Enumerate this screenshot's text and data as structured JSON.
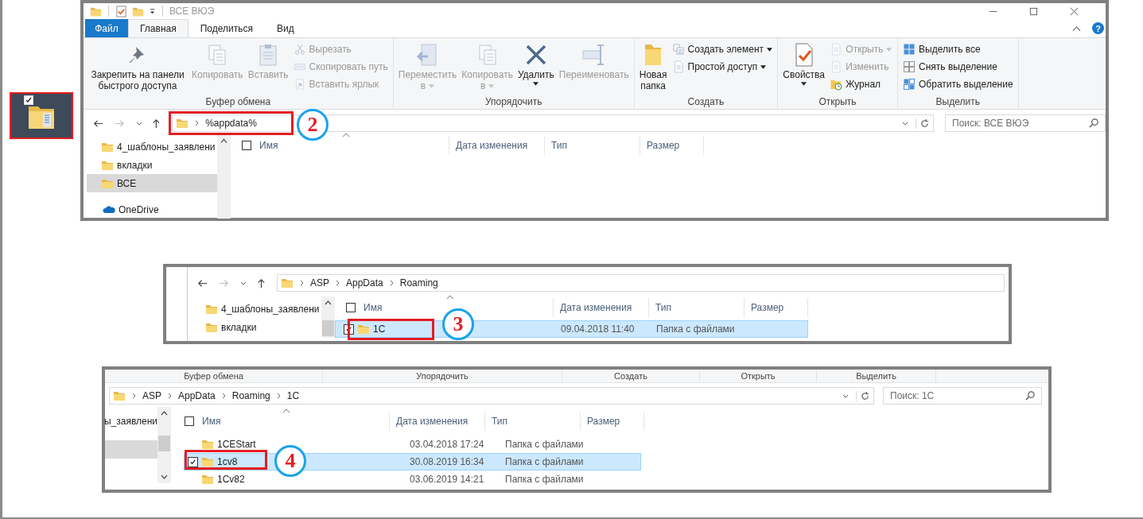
{
  "desktop_icon": {
    "checked": true
  },
  "window": {
    "title": "ВСЕ ВЮЭ",
    "help": "?",
    "tabs": [
      {
        "label": "Файл",
        "kind": "file",
        "selected": false
      },
      {
        "label": "Главная",
        "kind": "tab",
        "selected": true
      },
      {
        "label": "Поделиться",
        "kind": "tab",
        "selected": false
      },
      {
        "label": "Вид",
        "kind": "tab",
        "selected": false
      }
    ],
    "ribbon": [
      {
        "label": "Буфер обмена",
        "items": [
          {
            "label": "Закрепить на панели быстрого доступа",
            "kind": "large",
            "disabled": false,
            "dropdown": false
          },
          {
            "label": "Копировать",
            "kind": "large",
            "disabled": true,
            "dropdown": false
          },
          {
            "label": "Вставить",
            "kind": "large",
            "disabled": true,
            "dropdown": false
          },
          {
            "label": "Вырезать",
            "kind": "small",
            "disabled": true,
            "dropdown": false
          },
          {
            "label": "Скопировать путь",
            "kind": "small",
            "disabled": true,
            "dropdown": false
          },
          {
            "label": "Вставить ярлык",
            "kind": "small",
            "disabled": true,
            "dropdown": false
          }
        ]
      },
      {
        "label": "Упорядочить",
        "items": [
          {
            "label": "Переместить в",
            "kind": "large",
            "disabled": true,
            "dropdown": true
          },
          {
            "label": "Копировать в",
            "kind": "large",
            "disabled": true,
            "dropdown": true
          },
          {
            "label": "Удалить",
            "kind": "split",
            "disabled": false,
            "dropdown": true
          },
          {
            "label": "Переименовать",
            "kind": "large",
            "disabled": true,
            "dropdown": false
          }
        ]
      },
      {
        "label": "Создать",
        "items": [
          {
            "label": "Новая папка",
            "kind": "large",
            "disabled": false,
            "dropdown": false
          },
          {
            "label": "Создать элемент",
            "kind": "small",
            "disabled": false,
            "dropdown": true
          },
          {
            "label": "Простой доступ",
            "kind": "small",
            "disabled": false,
            "dropdown": true
          }
        ]
      },
      {
        "label": "Открыть",
        "items": [
          {
            "label": "Свойства",
            "kind": "split",
            "disabled": false,
            "dropdown": true
          },
          {
            "label": "Открыть",
            "kind": "small",
            "disabled": true,
            "dropdown": true
          },
          {
            "label": "Изменить",
            "kind": "small",
            "disabled": true,
            "dropdown": false
          },
          {
            "label": "Журнал",
            "kind": "small",
            "disabled": false,
            "dropdown": false
          }
        ]
      },
      {
        "label": "Выделить",
        "items": [
          {
            "label": "Выделить все",
            "kind": "small",
            "disabled": false,
            "dropdown": false
          },
          {
            "label": "Снять выделение",
            "kind": "small",
            "disabled": false,
            "dropdown": false
          },
          {
            "label": "Обратить выделение",
            "kind": "small",
            "disabled": false,
            "dropdown": false
          }
        ]
      }
    ],
    "path": [
      "%appdata%"
    ],
    "search": {
      "placeholder": "Поиск: ВСЕ ВЮЭ"
    },
    "nav": [
      {
        "label": "4_шаблоны_заявлени",
        "kind": "folder",
        "selected": false
      },
      {
        "label": "вкладки",
        "kind": "folder",
        "selected": false
      },
      {
        "label": "ВСЕ",
        "kind": "folder",
        "selected": true
      },
      {
        "label": "OneDrive",
        "kind": "cloud",
        "selected": false
      }
    ],
    "columns": [
      "Имя",
      "Дата изменения",
      "Тип",
      "Размер"
    ],
    "select_all": {
      "checked": false
    },
    "step": "2"
  },
  "window_2": {
    "path": [
      "ASP",
      "AppData",
      "Roaming"
    ],
    "nav": [
      {
        "label": "4_шаблоны_заявлени",
        "kind": "folder",
        "selected": false
      },
      {
        "label": "вкладки",
        "kind": "folder",
        "selected": false
      }
    ],
    "columns": [
      "Имя",
      "Дата изменения",
      "Тип",
      "Размер"
    ],
    "select_all": {
      "checked": false
    },
    "rows": [
      {
        "name": "1C",
        "date": "09.04.2018 11:40",
        "type": "Папка с файлами",
        "selected": true,
        "checked": true
      }
    ],
    "step": "3"
  },
  "window_3": {
    "ribbon_groups": [
      "Буфер обмена",
      "Упорядочить",
      "Создать",
      "Открыть",
      "Выделить"
    ],
    "path": [
      "ASP",
      "AppData",
      "Roaming",
      "1C"
    ],
    "search": {
      "placeholder": "Поиск: 1C"
    },
    "nav": [
      {
        "label": "ы_заявлени",
        "selected": false
      }
    ],
    "columns": [
      "Имя",
      "Дата изменения",
      "Тип",
      "Размер"
    ],
    "select_all": {
      "checked": false
    },
    "rows": [
      {
        "name": "1CEStart",
        "date": "03.04.2018 17:24",
        "type": "Папка с файлами",
        "selected": false,
        "checked": false
      },
      {
        "name": "1cv8",
        "date": "30.08.2019 16:34",
        "type": "Папка с файлами",
        "selected": true,
        "checked": true
      },
      {
        "name": "1Cv82",
        "date": "03.06.2019 14:21",
        "type": "Папка с файлами",
        "selected": false,
        "checked": false
      }
    ],
    "step": "4"
  }
}
